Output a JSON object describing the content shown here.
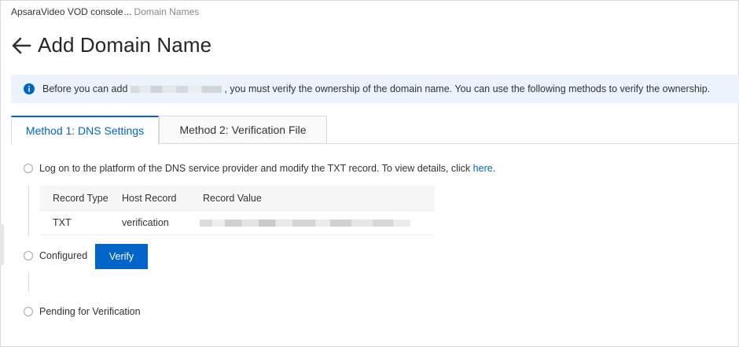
{
  "breadcrumb": {
    "root": "ApsaraVideo VOD console",
    "separator": "...",
    "current": "Domain Names"
  },
  "page": {
    "title": "Add Domain Name"
  },
  "notice": {
    "text_before": "Before you can add",
    "text_after": ", you must verify the ownership of the domain name. You can use the following methods to verify the ownership."
  },
  "tabs": [
    {
      "label": "Method 1: DNS Settings",
      "active": true
    },
    {
      "label": "Method 2: Verification File",
      "active": false
    }
  ],
  "steps": {
    "step1": {
      "text": "Log on to the platform of the DNS service provider and modify the TXT record. To view details, click ",
      "link": "here",
      "suffix": "."
    },
    "step2": {
      "label": "Configured",
      "button": "Verify"
    },
    "step3": {
      "label": "Pending for Verification"
    }
  },
  "record_table": {
    "headers": [
      "Record Type",
      "Host Record",
      "Record Value"
    ],
    "rows": [
      {
        "type": "TXT",
        "host": "verification"
      }
    ]
  },
  "colors": {
    "accent": "#0064c8",
    "notice_bg": "#ebf4fd"
  },
  "icons": {
    "back": "arrow-left-icon",
    "info": "info-circle-icon"
  }
}
